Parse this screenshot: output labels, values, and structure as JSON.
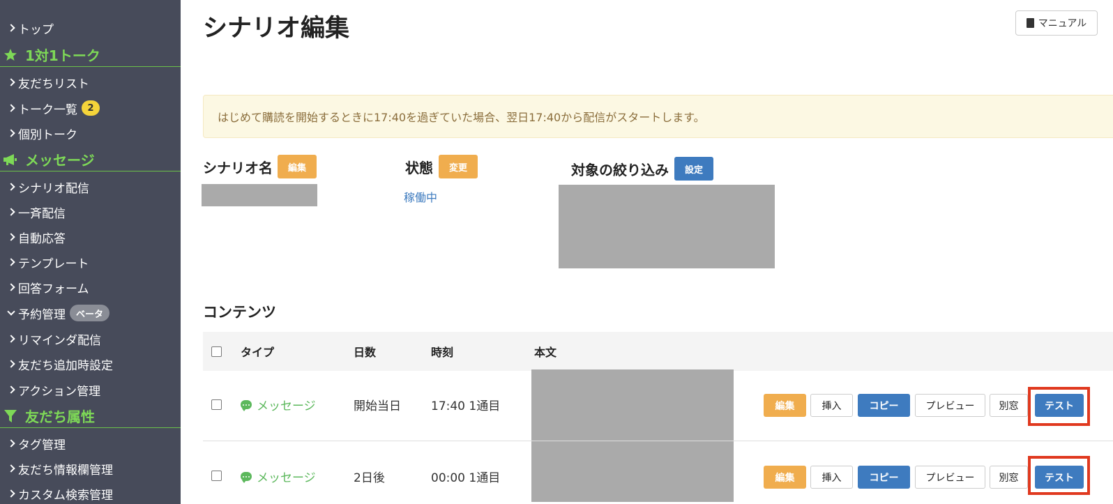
{
  "sidebar": {
    "items_top": [
      {
        "label": "トップ"
      }
    ],
    "sections": [
      {
        "label": "1対1トーク",
        "icon": "star-icon"
      },
      {
        "label": "メッセージ",
        "icon": "megaphone-icon"
      },
      {
        "label": "友だち属性",
        "icon": "filter-icon"
      }
    ],
    "talk_items": [
      {
        "label": "友だちリスト"
      },
      {
        "label": "トーク一覧",
        "badge": "2"
      },
      {
        "label": "個別トーク"
      }
    ],
    "message_items": [
      {
        "label": "シナリオ配信"
      },
      {
        "label": "一斉配信"
      },
      {
        "label": "自動応答"
      },
      {
        "label": "テンプレート"
      },
      {
        "label": "回答フォーム"
      },
      {
        "label": "予約管理",
        "badge": "ベータ"
      },
      {
        "label": "リマインダ配信"
      },
      {
        "label": "友だち追加時設定"
      },
      {
        "label": "アクション管理"
      }
    ],
    "attr_items": [
      {
        "label": "タグ管理"
      },
      {
        "label": "友だち情報欄管理"
      },
      {
        "label": "カスタム検索管理"
      }
    ]
  },
  "header": {
    "title": "シナリオ編集",
    "manual_label": "マニュアル"
  },
  "notice": "はじめて購読を開始するときに17:40を過ぎていた場合、翌日17:40から配信がスタートします。",
  "fields": {
    "scenario_name": {
      "label": "シナリオ名",
      "button": "編集"
    },
    "status": {
      "label": "状態",
      "button": "変更",
      "value": "稼働中"
    },
    "filter": {
      "label": "対象の絞り込み",
      "button": "設定"
    }
  },
  "contents": {
    "title": "コンテンツ",
    "columns": [
      "タイプ",
      "日数",
      "時刻",
      "本文"
    ],
    "rows": [
      {
        "type": "メッセージ",
        "day": "開始当日",
        "time": "17:40 1通目"
      },
      {
        "type": "メッセージ",
        "day": "2日後",
        "time": "00:00 1通目"
      }
    ],
    "actions": {
      "edit": "編集",
      "insert": "挿入",
      "copy": "コピー",
      "preview": "プレビュー",
      "window": "別窓",
      "test": "テスト"
    }
  },
  "colors": {
    "sidebar_bg": "#474b5a",
    "section_green": "#7ed957",
    "orange": "#f0ad4e",
    "blue": "#3e7bbf",
    "highlight_red": "#e0391f"
  }
}
